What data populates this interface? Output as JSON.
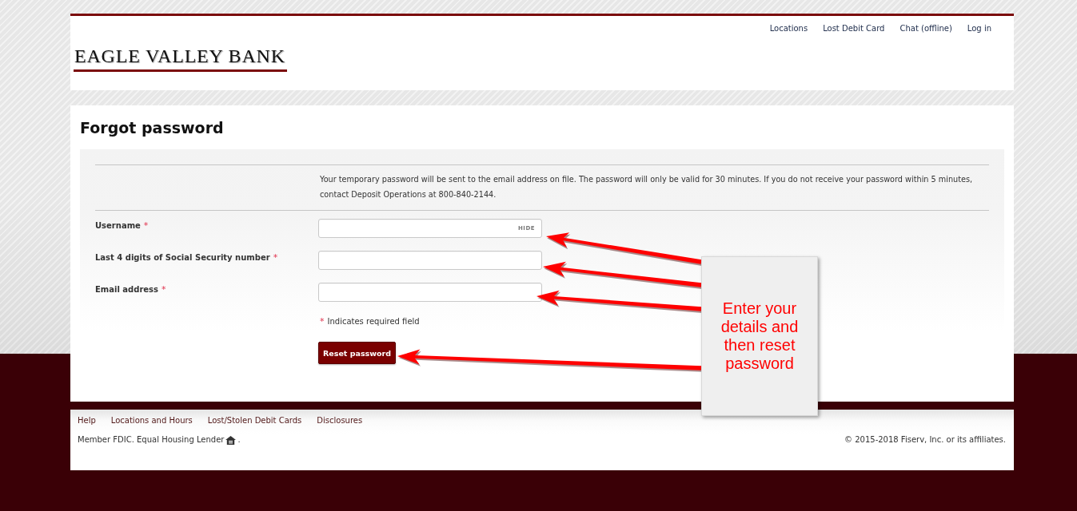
{
  "header": {
    "nav": [
      "Locations",
      "Lost Debit Card",
      "Chat (offline)",
      "Log in"
    ],
    "logo": "EAGLE VALLEY BANK"
  },
  "page": {
    "title": "Forgot password",
    "info": "Your temporary password will be sent to the email address on file. The password will only be valid for 30 minutes. If you do not receive your password within 5 minutes, contact Deposit Operations at 800-840-2144.",
    "fields": [
      {
        "label": "Username",
        "required_mark": "*",
        "toggle": "HIDE"
      },
      {
        "label": "Last 4 digits of Social Security number",
        "required_mark": "*"
      },
      {
        "label": "Email address",
        "required_mark": "*"
      }
    ],
    "required_note": {
      "mark": "*",
      "text": "Indicates required field"
    },
    "submit": "Reset password"
  },
  "footer": {
    "links": [
      "Help",
      "Locations and Hours",
      "Lost/Stolen Debit Cards",
      "Disclosures"
    ],
    "member_text": "Member FDIC. Equal Housing Lender",
    "member_suffix": ".",
    "copyright": "© 2015-2018 Fiserv, Inc. or its affiliates."
  },
  "annotation": {
    "text": "Enter your details and then reset password"
  }
}
